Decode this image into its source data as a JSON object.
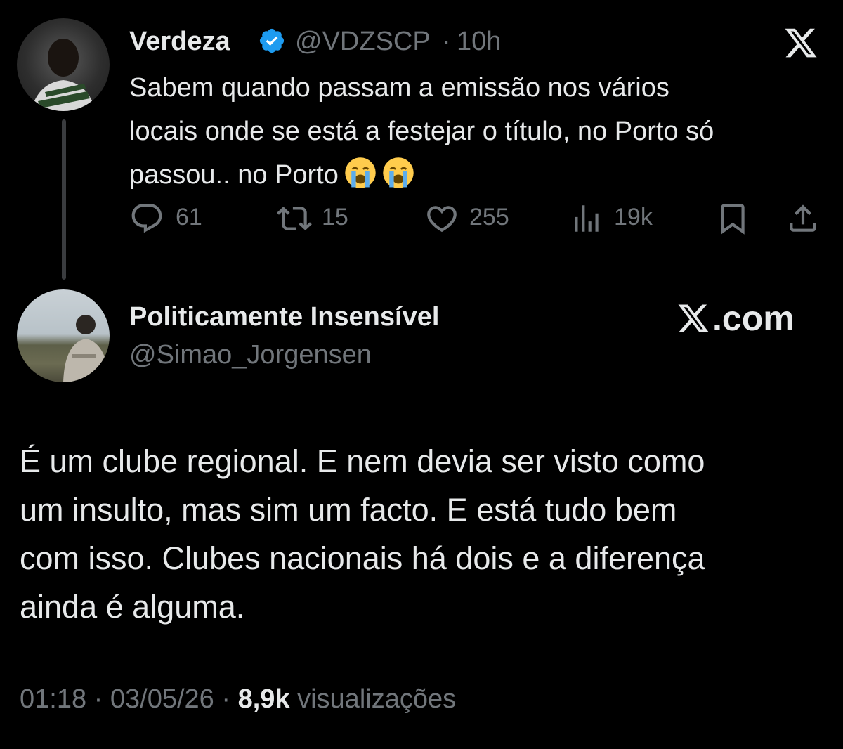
{
  "tweet_main": {
    "author_name": "Verdeza",
    "verified": true,
    "handle": "@VDZSCP",
    "separator": "·",
    "time": "10h",
    "text_lines": [
      "Sabem quando passam a emissão nos vários",
      "locais onde se está a festejar o título, no Porto só",
      "passou.. no Porto"
    ],
    "emojis": [
      "loudly-crying-face",
      "loudly-crying-face"
    ],
    "actions": {
      "replies": "61",
      "retweets": "15",
      "likes": "255",
      "views": "19k"
    }
  },
  "tweet_reply": {
    "author_name": "Politicamente Insensível",
    "handle": "@Simao_Jorgensen",
    "text_lines": [
      "É um clube regional. E nem devia ser visto como",
      "um insulto, mas sim um facto. E está tudo bem",
      "com isso. Clubes nacionais há dois e a diferença",
      "ainda é alguma."
    ],
    "footer": {
      "time": "01:18",
      "date": "03/05/26",
      "views_count": "8,9k",
      "views_label": "visualizações",
      "separator": "·"
    }
  },
  "branding": {
    "site_text": ".com"
  },
  "colors": {
    "background": "#000000",
    "text_primary": "#e7e9ea",
    "text_secondary": "#71767b",
    "verified_blue": "#1d9bf0",
    "thread_line": "#3a3c3f"
  }
}
